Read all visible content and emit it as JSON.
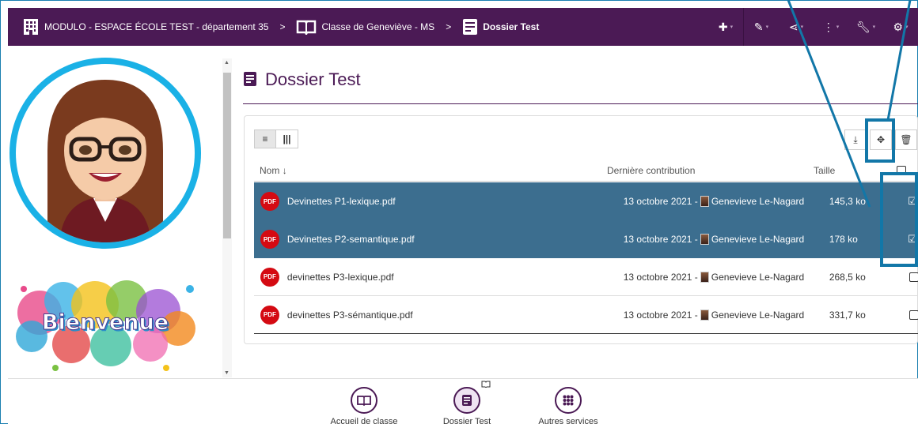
{
  "breadcrumb": {
    "items": [
      {
        "label": "MODULO - ESPACE ÉCOLE TEST - département 35",
        "icon": "building-icon"
      },
      {
        "label": "Classe de Geneviève - MS",
        "icon": "book-icon"
      },
      {
        "label": "Dossier Test",
        "icon": "document-icon"
      }
    ],
    "separator": ">"
  },
  "toolbar": {
    "items": [
      "plus-icon",
      "pencil-icon",
      "share-icon",
      "more-vertical-icon",
      "wrench-icon",
      "gear-icon"
    ]
  },
  "welcome_text": "Bienvenue",
  "page_title": "Dossier Test",
  "table": {
    "columns": {
      "name": "Nom",
      "contribution": "Dernière contribution",
      "size": "Taille"
    },
    "rows": [
      {
        "name": "Devinettes P1-lexique.pdf",
        "date": "13 octobre 2021 -",
        "author": "Genevieve Le-Nagard",
        "size": "145,3 ko",
        "selected": true
      },
      {
        "name": "Devinettes P2-semantique.pdf",
        "date": "13 octobre 2021 -",
        "author": "Genevieve Le-Nagard",
        "size": "178 ko",
        "selected": true
      },
      {
        "name": "devinettes P3-lexique.pdf",
        "date": "13 octobre 2021 -",
        "author": "Genevieve Le-Nagard",
        "size": "268,5 ko",
        "selected": false
      },
      {
        "name": "devinettes P3-sémantique.pdf",
        "date": "13 octobre 2021 -",
        "author": "Genevieve Le-Nagard",
        "size": "331,7 ko",
        "selected": false
      }
    ]
  },
  "file_badge": "PDF",
  "dock": {
    "items": [
      {
        "label": "Accueil de classe",
        "icon": "book-icon"
      },
      {
        "label": "Dossier Test",
        "icon": "document-icon"
      },
      {
        "label": "Autres services",
        "icon": "grid-icon"
      }
    ]
  },
  "colors": {
    "brand": "#4b1a55",
    "selected_row": "#3c6e8f",
    "annotation": "#1277a8",
    "pdf": "#d40a12"
  }
}
